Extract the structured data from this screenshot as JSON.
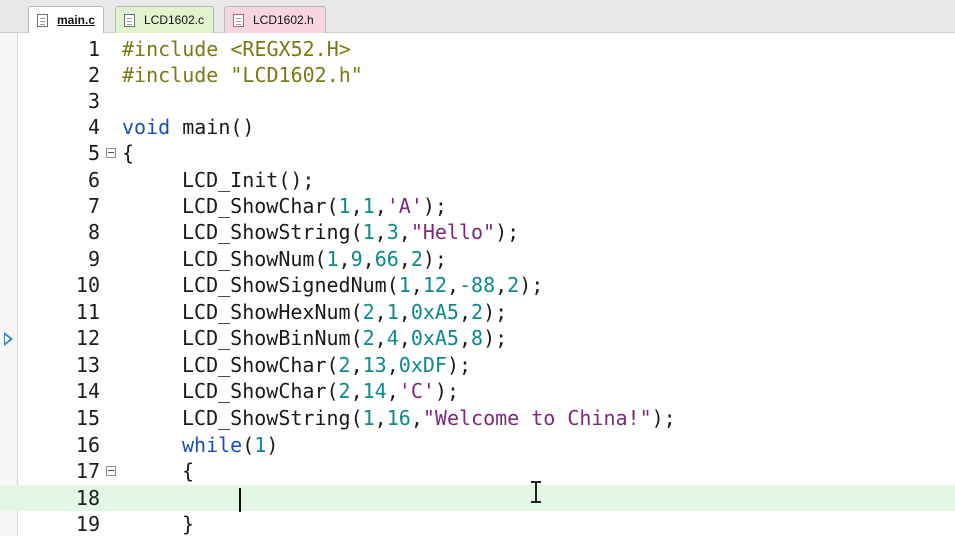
{
  "tabs": [
    {
      "label": "main.c",
      "active": true
    },
    {
      "label": "LCD1602.c",
      "active": false
    },
    {
      "label": "LCD1602.h",
      "active": false
    }
  ],
  "editor": {
    "current_line": 18,
    "lines": [
      {
        "n": "1"
      },
      {
        "n": "2"
      },
      {
        "n": "3"
      },
      {
        "n": "4"
      },
      {
        "n": "5"
      },
      {
        "n": "6"
      },
      {
        "n": "7"
      },
      {
        "n": "8"
      },
      {
        "n": "9"
      },
      {
        "n": "10"
      },
      {
        "n": "11"
      },
      {
        "n": "12"
      },
      {
        "n": "13"
      },
      {
        "n": "14"
      },
      {
        "n": "15"
      },
      {
        "n": "16"
      },
      {
        "n": "17"
      },
      {
        "n": "18"
      },
      {
        "n": "19"
      }
    ],
    "code": {
      "l1": "#include <REGX52.H>",
      "l2": "#include \"LCD1602.h\"",
      "l4_kw": "void",
      "l4_rest": " main()",
      "l5": "{",
      "l6": "LCD_Init();",
      "l7_fn": "LCD_ShowChar(",
      "l7_n1": "1",
      "l7_n2": "1",
      "l7_s": "'A'",
      "l7_end": ");",
      "l8_fn": "LCD_ShowString(",
      "l8_n1": "1",
      "l8_n2": "3",
      "l8_s": "\"Hello\"",
      "l8_end": ");",
      "l9_fn": "LCD_ShowNum(",
      "l9_n1": "1",
      "l9_n2": "9",
      "l9_n3": "66",
      "l9_n4": "2",
      "l9_end": ");",
      "l10_fn": "LCD_ShowSignedNum(",
      "l10_n1": "1",
      "l10_n2": "12",
      "l10_n3": "-88",
      "l10_n4": "2",
      "l10_end": ");",
      "l11_fn": "LCD_ShowHexNum(",
      "l11_n1": "2",
      "l11_n2": "1",
      "l11_n3": "0xA5",
      "l11_n4": "2",
      "l11_end": ");",
      "l12_fn": "LCD_ShowBinNum(",
      "l12_n1": "2",
      "l12_n2": "4",
      "l12_n3": "0xA5",
      "l12_n4": "8",
      "l12_end": ");",
      "l13_fn": "LCD_ShowChar(",
      "l13_n1": "2",
      "l13_n2": "13",
      "l13_n3": "0xDF",
      "l13_end": ");",
      "l14_fn": "LCD_ShowChar(",
      "l14_n1": "2",
      "l14_n2": "14",
      "l14_s": "'C'",
      "l14_end": ");",
      "l15_fn": "LCD_ShowString(",
      "l15_n1": "1",
      "l15_n2": "16",
      "l15_s": "\"Welcome to China!\"",
      "l15_end": ");",
      "l16_kw": "while",
      "l16_p1": "(",
      "l16_n": "1",
      "l16_p2": ")",
      "l17": "{",
      "l19": "}"
    }
  },
  "colors": {
    "preprocessor": "#7a7a14",
    "keyword": "#1a4fb8",
    "number": "#0a8a8a",
    "string": "#7a2a7a",
    "current_line_bg": "#e4f6e6"
  },
  "icons": {
    "tab_file": "file-icon",
    "fold": "fold-minus-icon",
    "execution_marker": "execution-arrow-icon",
    "mouse": "ibeam-cursor-icon"
  }
}
